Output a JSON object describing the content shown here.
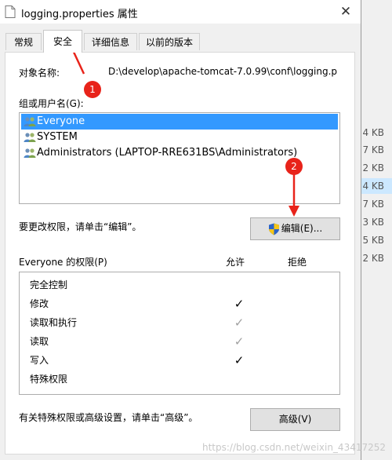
{
  "window": {
    "title": "logging.properties 属性",
    "close_glyph": "✕"
  },
  "tabs": [
    {
      "label": "常规",
      "active": false
    },
    {
      "label": "安全",
      "active": true
    },
    {
      "label": "详细信息",
      "active": false
    },
    {
      "label": "以前的版本",
      "active": false
    }
  ],
  "security": {
    "object_name_label": "对象名称:",
    "object_name_value": "D:\\develop\\apache-tomcat-7.0.99\\conf\\logging.p",
    "groups_label": "组或用户名(G):",
    "principals": [
      {
        "name": "Everyone",
        "selected": true
      },
      {
        "name": "SYSTEM",
        "selected": false
      },
      {
        "name": "Administrators (LAPTOP-RRE631BS\\Administrators)",
        "selected": false
      }
    ],
    "change_hint": "要更改权限，请单击“编辑”。",
    "edit_button": "编辑(E)...",
    "permissions_label": "Everyone 的权限(P)",
    "allow_header": "允许",
    "deny_header": "拒绝",
    "permissions": [
      {
        "name": "完全控制",
        "allow": "",
        "allow_state": "none",
        "deny": ""
      },
      {
        "name": "修改",
        "allow": "✓",
        "allow_state": "checked",
        "deny": ""
      },
      {
        "name": "读取和执行",
        "allow": "✓",
        "allow_state": "inherited",
        "deny": ""
      },
      {
        "name": "读取",
        "allow": "✓",
        "allow_state": "inherited",
        "deny": ""
      },
      {
        "name": "写入",
        "allow": "✓",
        "allow_state": "checked",
        "deny": ""
      },
      {
        "name": "特殊权限",
        "allow": "",
        "allow_state": "none",
        "deny": ""
      }
    ],
    "advanced_hint": "有关特殊权限或高级设置，请单击“高级”。",
    "advanced_button": "高级(V)"
  },
  "annotations": {
    "badge_1": "1",
    "badge_2": "2",
    "color": "#e8231a"
  },
  "background_sizes": [
    "4 KB",
    "7 KB",
    "2 KB",
    "4 KB",
    "7 KB",
    "3 KB",
    "5 KB",
    "2 KB"
  ],
  "watermark": "https://blog.csdn.net/weixin_43417252",
  "colors": {
    "selection": "#3399ff",
    "dialog_bg": "#f0f0f0",
    "button_bg": "#e1e1e1"
  }
}
